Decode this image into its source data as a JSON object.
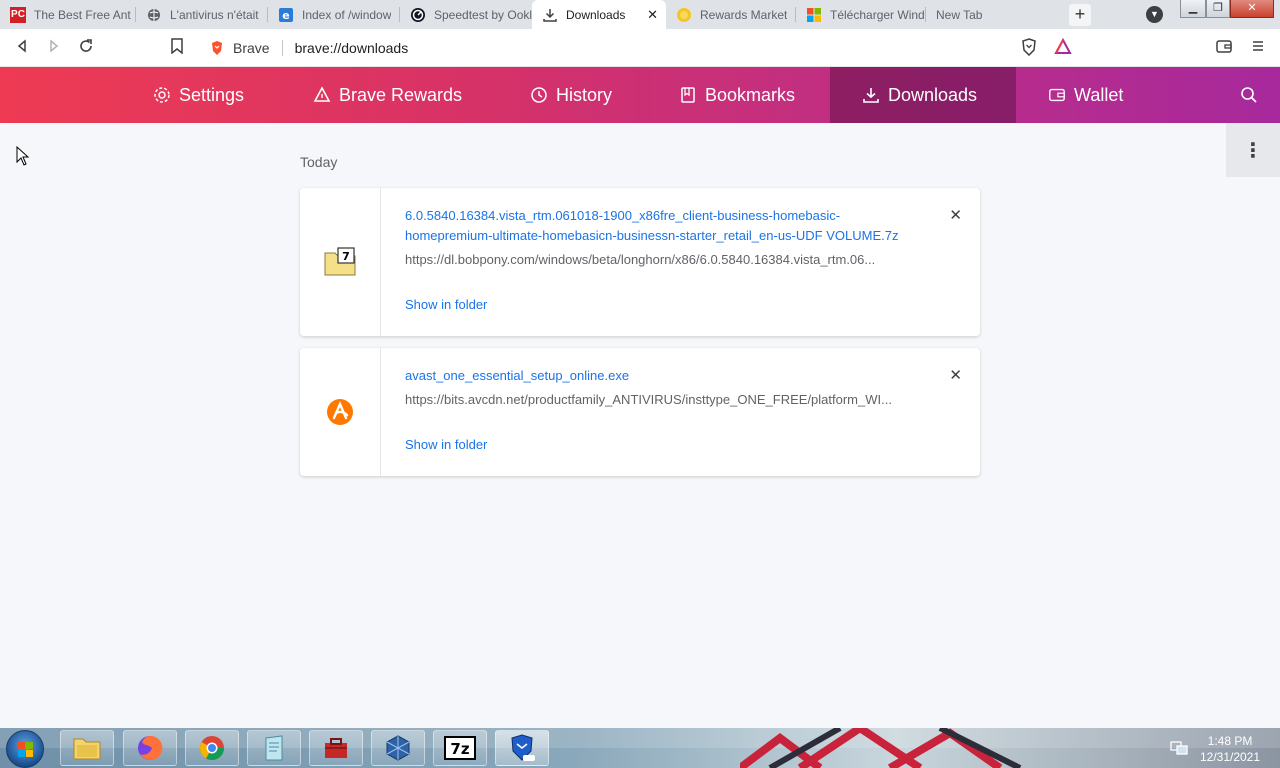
{
  "tabs": [
    {
      "title": "The Best Free Ant",
      "icon": "pcmag-icon"
    },
    {
      "title": "L'antivirus n'était",
      "icon": "globe-icon"
    },
    {
      "title": "Index of /window",
      "icon": "ie-icon"
    },
    {
      "title": "Speedtest by Ookla",
      "icon": "speedtest-icon"
    },
    {
      "title": "Downloads",
      "icon": "download-icon"
    },
    {
      "title": "Rewards Market",
      "icon": "rewards-icon"
    },
    {
      "title": "Télécharger Wind",
      "icon": "microsoft-icon"
    },
    {
      "title": "New Tab",
      "icon": ""
    }
  ],
  "address": {
    "site_label": "Brave",
    "url": "brave://downloads"
  },
  "nav": {
    "settings": "Settings",
    "rewards": "Brave Rewards",
    "history": "History",
    "bookmarks": "Bookmarks",
    "downloads": "Downloads",
    "wallet": "Wallet"
  },
  "section_label": "Today",
  "downloads": [
    {
      "filename": "6.0.5840.16384.vista_rtm.061018-1900_x86fre_client-business-homebasic-homepremium-ultimate-homebasicn-businessn-starter_retail_en-us-UDF VOLUME.7z",
      "url": "https://dl.bobpony.com/windows/beta/longhorn/x86/6.0.5840.16384.vista_rtm.06...",
      "action": "Show in folder",
      "icon": "7z-archive-icon"
    },
    {
      "filename": "avast_one_essential_setup_online.exe",
      "url": "https://bits.avcdn.net/productfamily_ANTIVIRUS/insttype_ONE_FREE/platform_WI...",
      "action": "Show in folder",
      "icon": "avast-icon"
    }
  ],
  "clock": {
    "time": "1:48 PM",
    "date": "12/31/2021"
  },
  "colors": {
    "nav_start": "#ee3b53",
    "nav_end": "#a7299c",
    "link": "#1a73e8"
  }
}
